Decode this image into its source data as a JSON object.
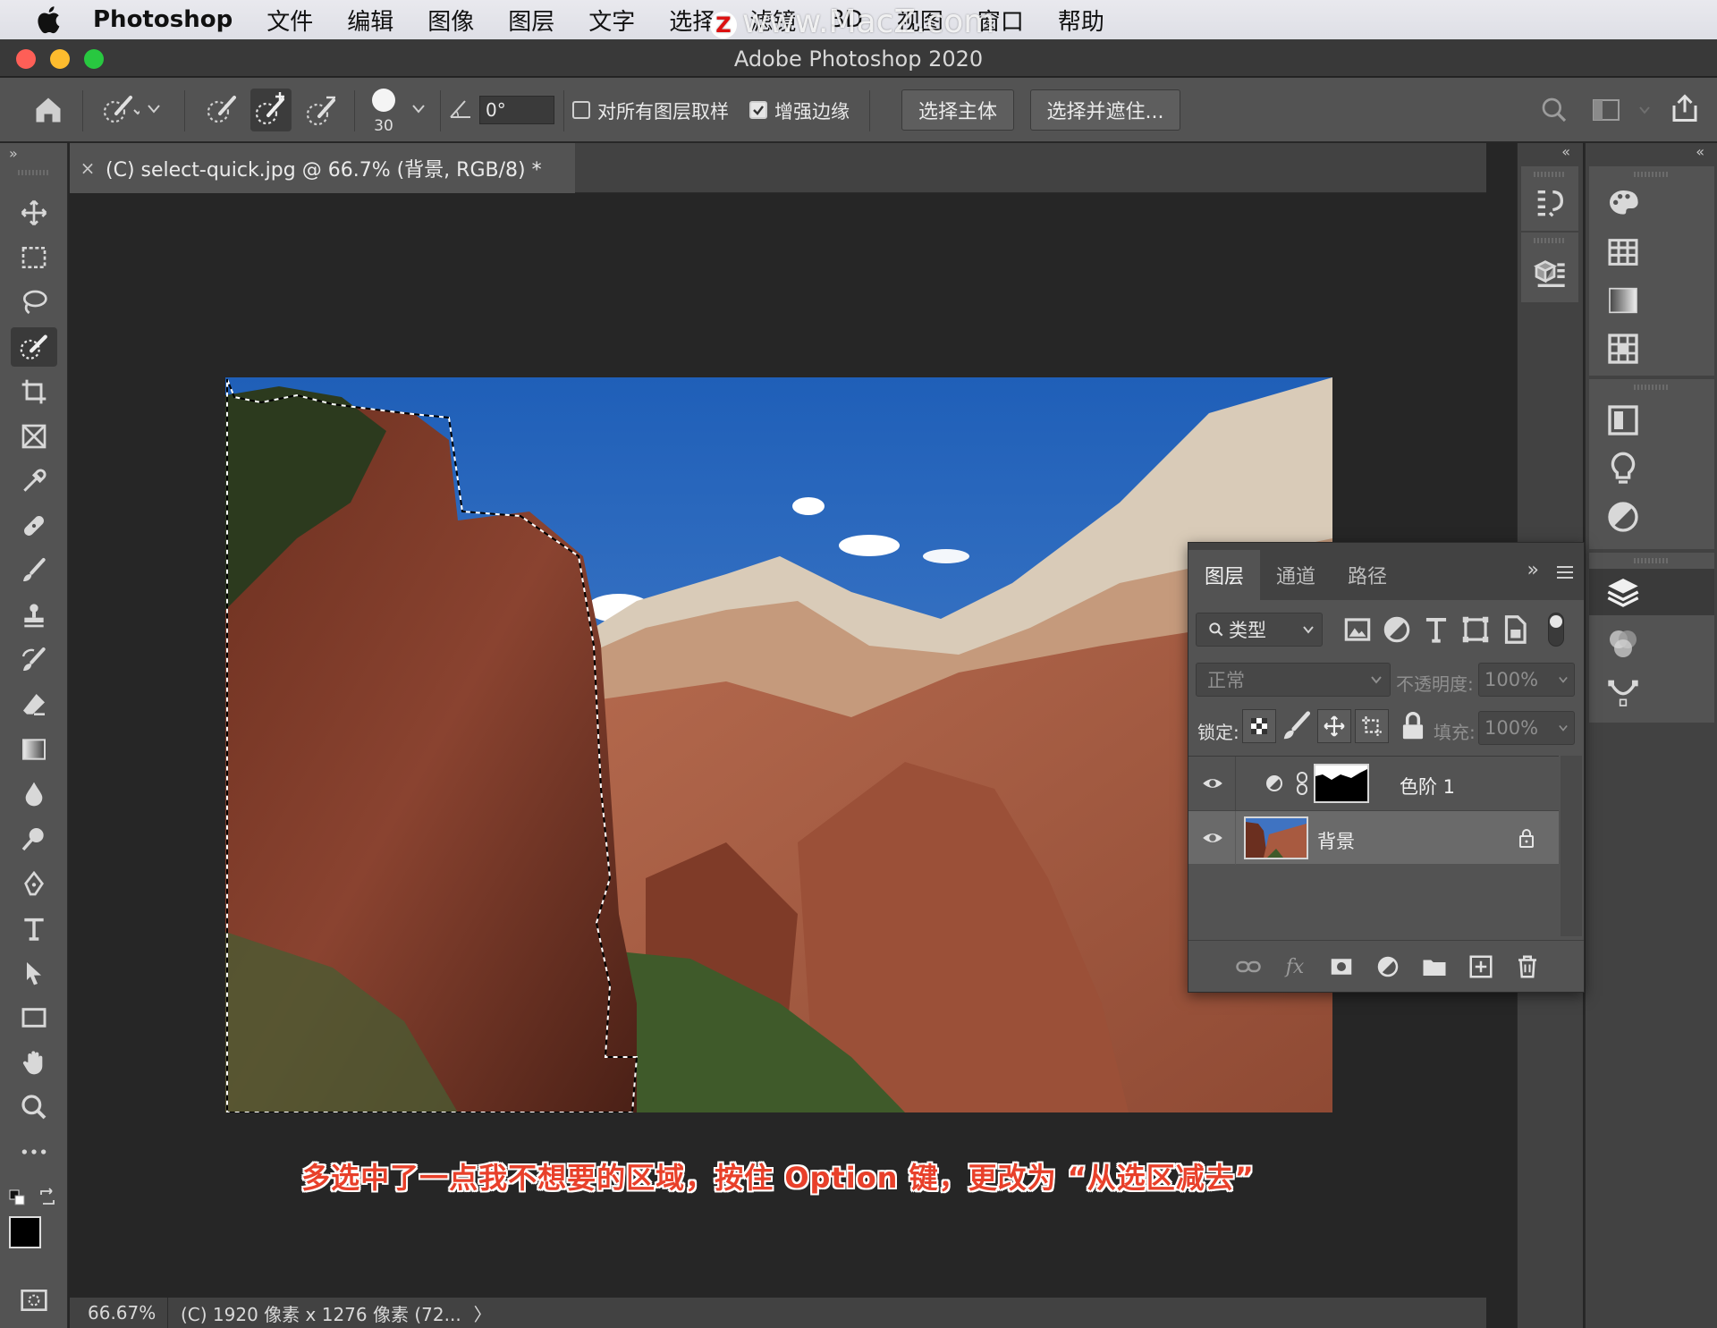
{
  "menubar": {
    "app_name": "Photoshop",
    "items": [
      "文件",
      "编辑",
      "图像",
      "图层",
      "文字",
      "选择",
      "滤镜",
      "3D",
      "视图",
      "窗口",
      "帮助"
    ],
    "watermark": "www.MacZ.com",
    "watermark_badge": "Z"
  },
  "window": {
    "title": "Adobe Photoshop 2020"
  },
  "options": {
    "brush_size": "30",
    "angle": "0°",
    "sample_all_layers": {
      "label": "对所有图层取样",
      "checked": false
    },
    "auto_enhance": {
      "label": "增强边缘",
      "checked": true
    },
    "select_subject": "选择主体",
    "select_and_mask": "选择并遮住..."
  },
  "document": {
    "tab_title": "(C) select-quick.jpg @ 66.7% (背景, RGB/8) *",
    "close": "×",
    "caption": "多选中了一点我不想要的区域，按住 Option 键，更改为 “从选区减去”"
  },
  "status": {
    "zoom": "66.67%",
    "info": "(C) 1920 像素 x 1276 像素 (72...",
    "arrow": "〉"
  },
  "layers_panel": {
    "tabs": [
      "图层",
      "通道",
      "路径"
    ],
    "filter": "类型",
    "blend_mode": "正常",
    "opacity_label": "不透明度:",
    "opacity": "100%",
    "lock_label": "锁定:",
    "fill_label": "填充:",
    "fill": "100%",
    "layers": [
      {
        "name": "色阶 1",
        "type": "adjustment",
        "visible": true
      },
      {
        "name": "背景",
        "type": "image",
        "visible": true,
        "locked": true,
        "selected": true
      }
    ]
  },
  "colors": {
    "accent_caption": "#e8402a",
    "panel": "#535353",
    "dark": "#262626"
  }
}
